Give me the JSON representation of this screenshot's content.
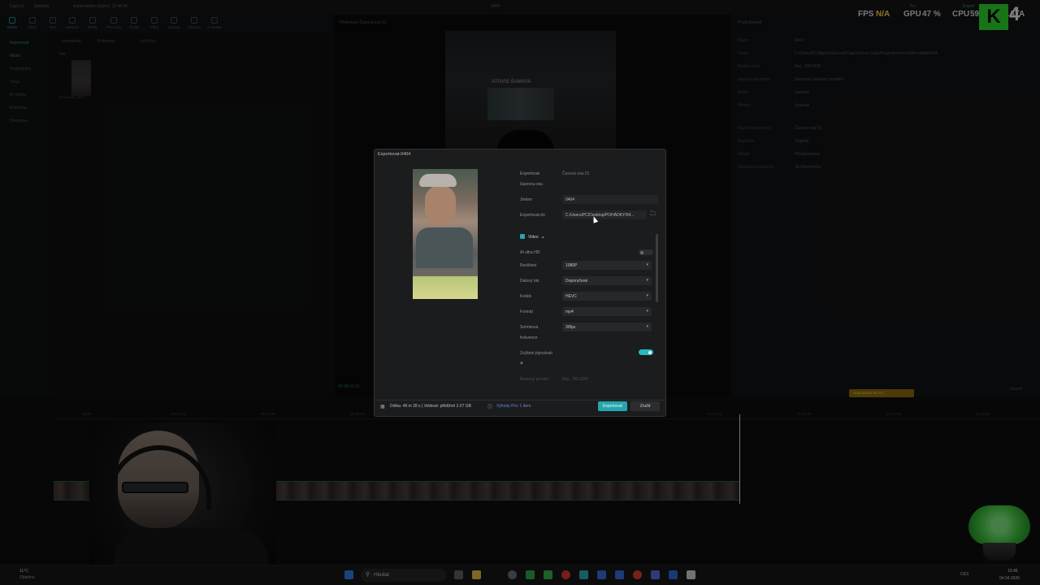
{
  "app": {
    "name": "CapCut",
    "menu": "Nabídka",
    "autosave": "Automatické uložení: 11:44:36",
    "project_name": "0404",
    "pro_label": "Pro",
    "export_label": "Export"
  },
  "toolbar": {
    "items": [
      "Média",
      "Zvuk",
      "Text",
      "Nálepky",
      "Efekty",
      "Přechody",
      "Titulky",
      "Filtry",
      "Úpravy",
      "Šablony",
      "AI avatar"
    ]
  },
  "media_tabs": {
    "import": "Importovat",
    "library": "Knihovna",
    "search": "Vyhledat"
  },
  "left_nav": {
    "items": [
      "Importovat",
      "Místní",
      "Podprojekty",
      "Tvoje",
      "AI média",
      "Knihovna",
      "Dreamina"
    ]
  },
  "media_panel": {
    "folder_label": "Vše",
    "clip_name": "obrazovka_004_...",
    "clip_badge": "Přidáno"
  },
  "preview": {
    "header": "Přehrávač-Časová osa 01",
    "timecode_current": "00:48:20:13",
    "frame_sign": "ATOVIS ŠUMAVA"
  },
  "details": {
    "title": "Podrobnosti",
    "rows": [
      {
        "label": "Název",
        "value": "0404"
      },
      {
        "label": "Cesta",
        "value": "C:/Users/PC/AppData/Local/CapCut/User Data/Projects/com.lveditor.draft/0404"
      },
      {
        "label": "Poměr stran",
        "value": "Rec. 709 SDR"
      },
      {
        "label": "Importování médií",
        "value": "Zachovat původní umístění"
      },
      {
        "label": "Proxy",
        "value": "Zapnuto"
      },
      {
        "label": "Přenos",
        "value": "Vypnuto"
      },
      {
        "label": "Název časové osy",
        "value": "Časová osa 01"
      },
      {
        "label": "Rozlišení",
        "value": "Originál"
      },
      {
        "label": "Poměr",
        "value": "Přizpůsobeno"
      },
      {
        "label": "Snímková frekvence",
        "value": "30.00snímků/s"
      }
    ],
    "modify_button": "Upravit"
  },
  "hud": {
    "fps_label": "FPS",
    "fps_value": "N/A",
    "gpu_label": "GPU",
    "gpu_value": "47 %",
    "cpu_label": "CPU",
    "cpu_value": "59",
    "logo_letter": "K",
    "logo_number": "4",
    "latency_label": "LATA"
  },
  "timeline": {
    "ruler_marks": [
      "00:00",
      "00:10:00",
      "00:20:00",
      "00:30:00",
      "00:40:00",
      "00:50:00",
      "01:00:00",
      "01:10:00",
      "01:20:00",
      "01:30:00",
      "01:40:00",
      "01:50:00",
      "02:00:00"
    ],
    "promo_button": "Upgradovat na Pro"
  },
  "export_dialog": {
    "title": "Exportovat-0404",
    "export_label": "Exportovat",
    "export_sub": "časovou osu",
    "export_value": "Časová osa 01",
    "name_label": "Jméno",
    "name_value": "0404",
    "export_to_label": "Exportovat do",
    "export_to_value": "C:/Users/PC/Desktop/POHÁDKY/04...",
    "video_section": "Video",
    "ai_ultra_label": "AI ultra HD",
    "resolution_label": "Rozlišení",
    "resolution_value": "1080P",
    "bitrate_label": "Datový tok",
    "bitrate_value": "Doporučené",
    "codec_label": "Kodek",
    "codec_value": "HEVC",
    "format_label": "Formát",
    "format_value": "mp4",
    "framerate_label": "Snímková",
    "framerate_label2": "frekvence",
    "framerate_value": "30fps",
    "smooth_label": "Zvýšení plynulosti",
    "color_label": "Barevný prostor",
    "color_value": "Rec. 709 SDR",
    "footer_info": "Délka: 48 m 28 s | Velikost: přibližně 2.07 GB",
    "pro_benefit": "Výhody Pro: 1 item",
    "export_button": "Exportovat",
    "cancel_button": "Zrušit"
  },
  "taskbar": {
    "weather": "11°C",
    "weather_sub": "Oblačno",
    "search_placeholder": "Hledat",
    "lang": "CES",
    "time": "13:45",
    "date": "04.04.2026"
  }
}
